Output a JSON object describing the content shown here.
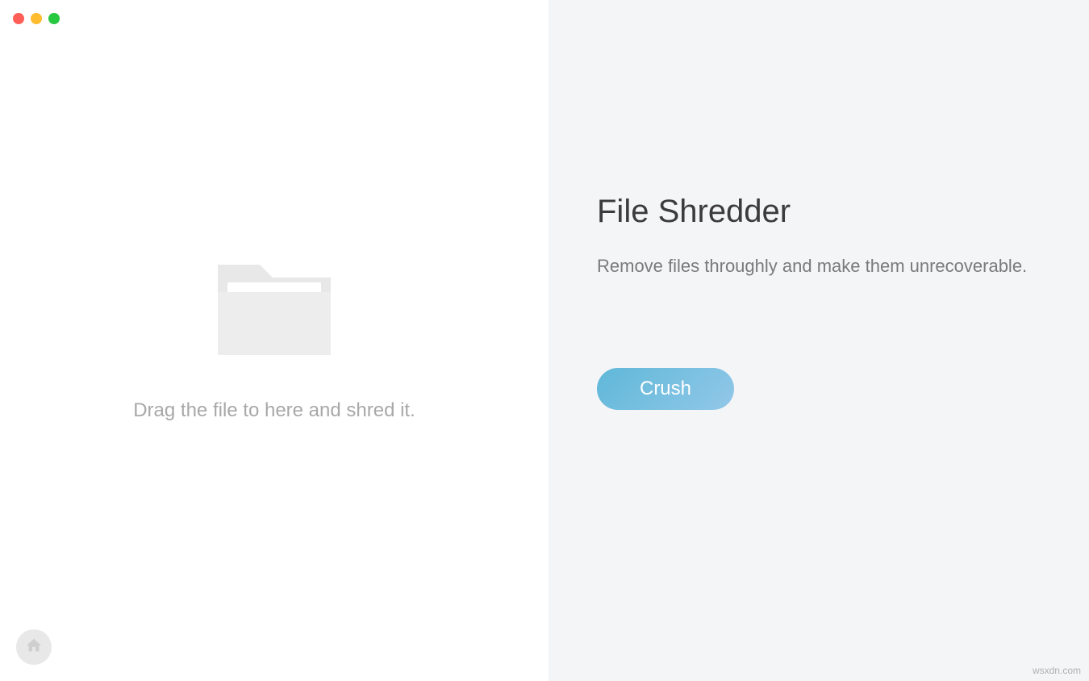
{
  "window": {
    "trafficLights": {
      "close": "close",
      "minimize": "minimize",
      "maximize": "maximize"
    }
  },
  "leftPane": {
    "dropText": "Drag the file to here and shred it.",
    "folderIcon": "folder-icon",
    "homeIcon": "home-icon"
  },
  "rightPane": {
    "title": "File Shredder",
    "subtitle": "Remove files throughly and make them unrecoverable.",
    "crushButtonLabel": "Crush"
  },
  "watermark": "wsxdn.com"
}
